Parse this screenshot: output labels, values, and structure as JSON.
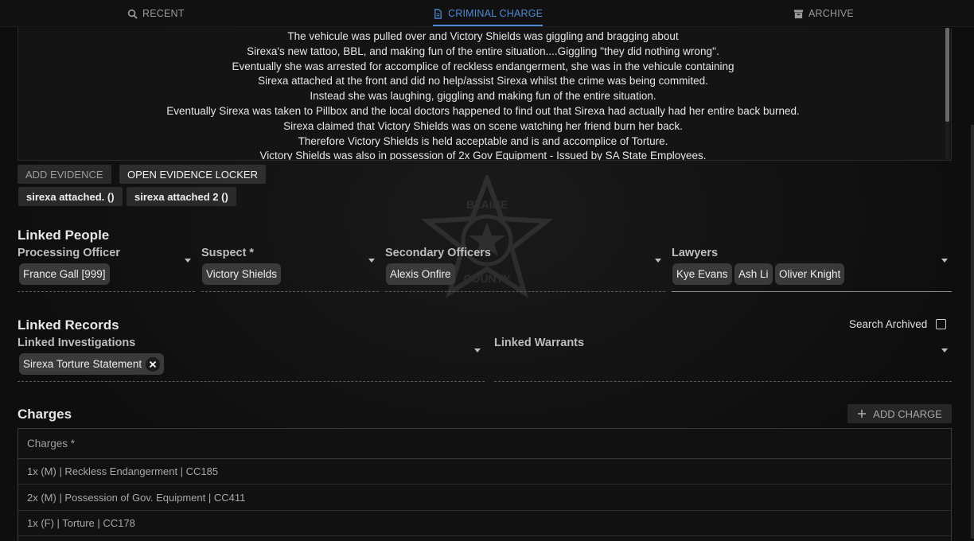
{
  "nav": {
    "tabs": [
      {
        "label": "RECENT",
        "icon": "search-icon"
      },
      {
        "label": "CRIMINAL CHARGE",
        "icon": "document-icon",
        "active": true
      },
      {
        "label": "ARCHIVE",
        "icon": "archive-icon"
      }
    ]
  },
  "narrative": {
    "lines": [
      "The vehicule was pulled over and Victory Shields was giggling and bragging about",
      "Sirexa's new tattoo, BBL, and making fun of the entire situation....Giggling ''they did nothing wrong''.",
      "Eventually she was arrested for accomplice of reckless endangerment, she was in the vehicule containing",
      "Sirexa attached at the front and did no help/assist Sirexa whilst the crime was being commited.",
      "Instead she was laughing, giggling and making fun of the entire situation.",
      "Eventually Sirexa was taken to Pillbox and the local doctors happened to find out that Sirexa had actually had her entire back burned.",
      "Sirexa claimed that Victory Shields was on scene watching her friend burn her back.",
      "Therefore Victory Shields is held acceptable and is and accomplice of Torture.",
      "Victory Shields was also in possession of 2x Gov Equipment - Issued by SA State Employees."
    ]
  },
  "evidence": {
    "add_label": "ADD EVIDENCE",
    "locker_label": "OPEN EVIDENCE LOCKER",
    "items": [
      "sirexa attached. ()",
      "sirexa attached 2 ()"
    ]
  },
  "linked_people": {
    "title": "Linked People",
    "processing_officer": {
      "label": "Processing Officer",
      "values": [
        "France Gall [999]"
      ]
    },
    "suspect": {
      "label": "Suspect *",
      "values": [
        "Victory Shields"
      ]
    },
    "secondary_officers": {
      "label": "Secondary Officers",
      "values": [
        "Alexis Onfire"
      ]
    },
    "lawyers": {
      "label": "Lawyers",
      "values": [
        "Kye Evans",
        "Ash Li",
        "Oliver Knight"
      ]
    }
  },
  "linked_records": {
    "title": "Linked Records",
    "search_archived_label": "Search Archived",
    "search_archived_checked": false,
    "investigations": {
      "label": "Linked Investigations",
      "values": [
        "Sirexa Torture Statement"
      ]
    },
    "warrants": {
      "label": "Linked Warrants",
      "values": []
    }
  },
  "charges": {
    "title": "Charges",
    "add_label": "ADD CHARGE",
    "header": "Charges *",
    "rows": [
      "1x (M) | Reckless Endangerment | CC185",
      "2x (M) | Possession of Gov. Equipment | CC411",
      "1x (F) | Torture | CC178"
    ]
  },
  "watermark": {
    "lines": [
      "BLAINE",
      "COUNTY"
    ]
  },
  "colors": {
    "accent": "#4f8bd6",
    "background": "#0e0e0e"
  }
}
